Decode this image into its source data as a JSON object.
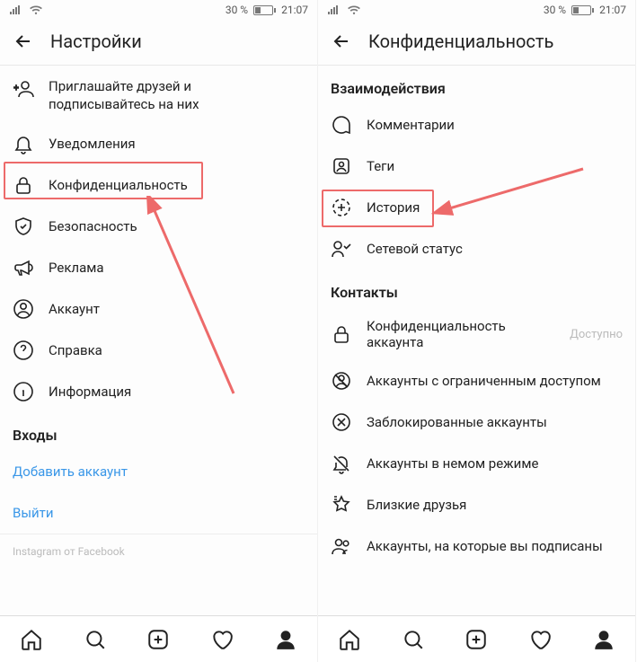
{
  "status": {
    "battery_pct": "30 %",
    "time": "21:07"
  },
  "left": {
    "header": "Настройки",
    "items": [
      {
        "line1": "Приглашайте друзей и",
        "line2": "подписывайтесь на них"
      },
      {
        "label": "Уведомления"
      },
      {
        "label": "Конфиденциальность"
      },
      {
        "label": "Безопасность"
      },
      {
        "label": "Реклама"
      },
      {
        "label": "Аккаунт"
      },
      {
        "label": "Справка"
      },
      {
        "label": "Информация"
      }
    ],
    "section_logins": "Входы",
    "add_account": "Добавить аккаунт",
    "logout": "Выйти",
    "footer": "Instagram от Facebook"
  },
  "right": {
    "header": "Конфиденциальность",
    "section_interactions": "Взаимодействия",
    "interactions": [
      {
        "label": "Комментарии"
      },
      {
        "label": "Теги"
      },
      {
        "label": "История"
      },
      {
        "label": "Сетевой статус"
      }
    ],
    "section_contacts": "Контакты",
    "contacts": [
      {
        "label": "Конфиденциальность аккаунта",
        "trailing": "Доступно"
      },
      {
        "label": "Аккаунты с ограниченным доступом"
      },
      {
        "label": "Заблокированные аккаунты"
      },
      {
        "label": "Аккаунты в немом режиме"
      },
      {
        "label": "Близкие друзья"
      },
      {
        "label": "Аккаунты, на которые вы подписаны"
      }
    ]
  }
}
